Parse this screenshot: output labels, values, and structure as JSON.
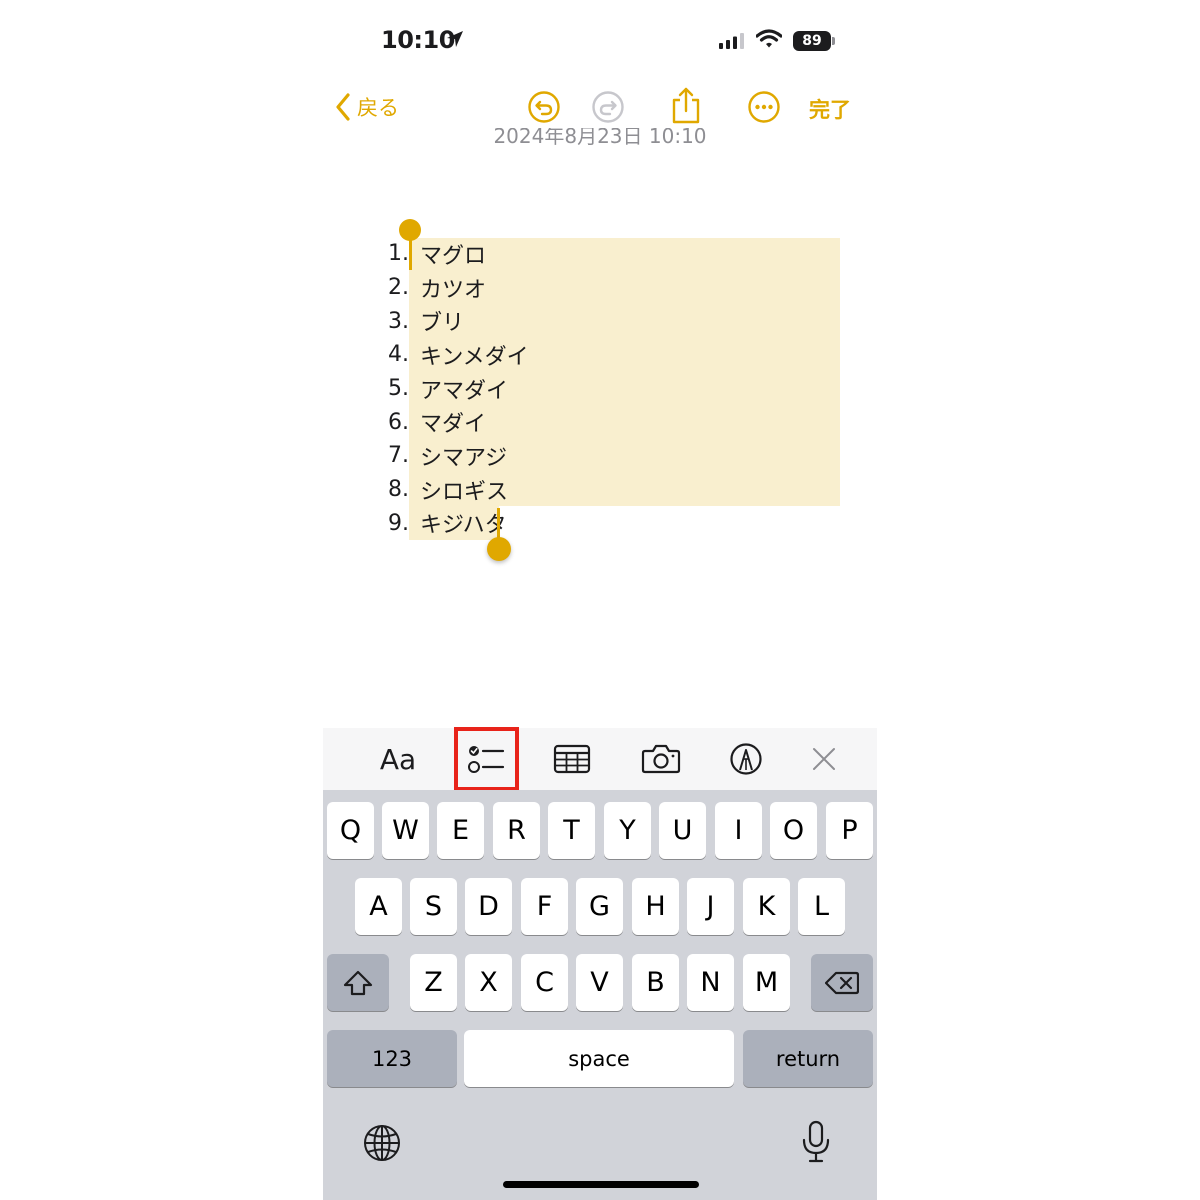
{
  "status": {
    "time": "10:10",
    "battery": "89"
  },
  "nav": {
    "back_label": "戻る",
    "done_label": "完了"
  },
  "note": {
    "date": "2024年8月23日 10:10",
    "items": [
      {
        "num": "1.",
        "text": "マグロ"
      },
      {
        "num": "2.",
        "text": "カツオ"
      },
      {
        "num": "3.",
        "text": "ブリ"
      },
      {
        "num": "4.",
        "text": "キンメダイ"
      },
      {
        "num": "5.",
        "text": "アマダイ"
      },
      {
        "num": "6.",
        "text": "マダイ"
      },
      {
        "num": "7.",
        "text": "シマアジ"
      },
      {
        "num": "8.",
        "text": "シロギス"
      },
      {
        "num": "9.",
        "text": "キジハタ"
      }
    ]
  },
  "toolbar": {
    "format_label": "Aa",
    "icons": [
      "checklist-icon",
      "table-icon",
      "camera-icon",
      "markup-icon",
      "close-icon"
    ],
    "highlighted": "checklist-icon"
  },
  "keyboard": {
    "row1": [
      "Q",
      "W",
      "E",
      "R",
      "T",
      "Y",
      "U",
      "I",
      "O",
      "P"
    ],
    "row2": [
      "A",
      "S",
      "D",
      "F",
      "G",
      "H",
      "J",
      "K",
      "L"
    ],
    "row3": [
      "Z",
      "X",
      "C",
      "V",
      "B",
      "N",
      "M"
    ],
    "numbers_label": "123",
    "space_label": "space",
    "return_label": "return",
    "icons": [
      "shift-icon",
      "delete-icon",
      "globe-icon",
      "microphone-icon"
    ]
  },
  "colors": {
    "accent": "#e0a800",
    "selection": "#f9efcf",
    "highlight_box": "#e8231a",
    "keyboard_bg": "#d1d3d9"
  }
}
